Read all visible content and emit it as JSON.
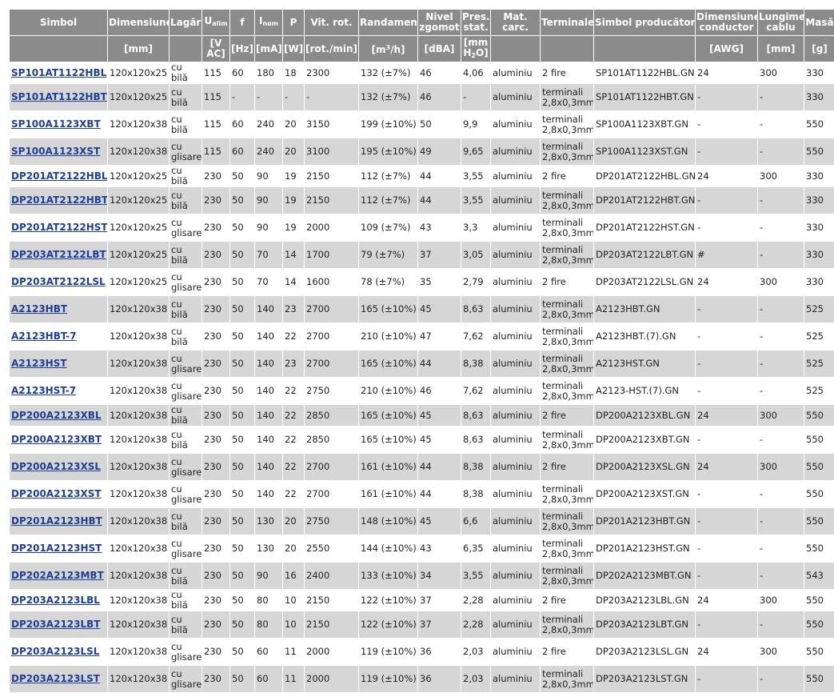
{
  "headers": [
    {
      "key": "simbol",
      "l1": "Simbol",
      "unit": ""
    },
    {
      "key": "dim",
      "l1": "Dimensiune",
      "unit": "[mm]"
    },
    {
      "key": "lagar",
      "l1": "Lagăr",
      "unit": ""
    },
    {
      "key": "ualim",
      "l1": "U",
      "sub": "alim",
      "unit": "[V AC]"
    },
    {
      "key": "f",
      "l1": "f",
      "unit": "[Hz]"
    },
    {
      "key": "inom",
      "l1": "I",
      "sub": "nom",
      "unit": "[mA]"
    },
    {
      "key": "p",
      "l1": "P",
      "unit": "[W]"
    },
    {
      "key": "vit",
      "l1": "Vit. rot.",
      "unit": "[rot./min]"
    },
    {
      "key": "rand",
      "l1": "Randament",
      "unit": "[m",
      "sup": "3",
      "unit_tail": "/h]"
    },
    {
      "key": "zgomot",
      "l1": "Nivel zgomot",
      "unit": "[dBA]"
    },
    {
      "key": "pres",
      "l1": "Pres. stat.",
      "unit": "[mm H",
      "unit_sub": "2",
      "unit_tail": "O]"
    },
    {
      "key": "mat",
      "l1": "Mat. carc.",
      "unit": ""
    },
    {
      "key": "term",
      "l1": "Terminale",
      "unit": ""
    },
    {
      "key": "simprod",
      "l1": "Simbol producător",
      "unit": ""
    },
    {
      "key": "dimcond",
      "l1": "Dimensiune conductor",
      "unit": "[AWG]"
    },
    {
      "key": "lung",
      "l1": "Lungime cablu",
      "unit": "[mm]"
    },
    {
      "key": "masa",
      "l1": "Masă",
      "unit": "[g]"
    }
  ],
  "rows": [
    [
      "SP101AT1122HBL",
      "120x120x25",
      "cu bilă",
      "115",
      "60",
      "180",
      "18",
      "2300",
      "132 (±7%)",
      "46",
      "4,06",
      "aluminiu",
      "2 fire",
      "SP101AT1122HBL.GN",
      "24",
      "300",
      "330"
    ],
    [
      "SP101AT1122HBT",
      "120x120x25",
      "cu bilă",
      "115",
      "-",
      "-",
      "-",
      "-",
      "132 (±7%)",
      "46",
      "-",
      "aluminiu",
      "terminali 2,8x0,3mm",
      "SP101AT1122HBT.GN",
      "-",
      "-",
      "330"
    ],
    [
      "SP100A1123XBT",
      "120x120x38",
      "cu bilă",
      "115",
      "60",
      "240",
      "20",
      "3150",
      "199 (±10%)",
      "50",
      "9,9",
      "aluminiu",
      "terminali 2,8x0,3mm",
      "SP100A1123XBT.GN",
      "-",
      "-",
      "550"
    ],
    [
      "SP100A1123XST",
      "120x120x38",
      "cu glisare",
      "115",
      "60",
      "240",
      "20",
      "3100",
      "195 (±10%)",
      "49",
      "9,65",
      "aluminiu",
      "terminali 2,8x0,3mm",
      "SP100A1123XST.GN",
      "-",
      "-",
      "550"
    ],
    [
      "DP201AT2122HBL",
      "120x120x25",
      "cu bilă",
      "230",
      "50",
      "90",
      "19",
      "2150",
      "112 (±7%)",
      "44",
      "3,55",
      "aluminiu",
      "2 fire",
      "DP201AT2122HBL.GN",
      "24",
      "300",
      "330"
    ],
    [
      "DP201AT2122HBT",
      "120x120x25",
      "cu bilă",
      "230",
      "50",
      "90",
      "19",
      "2150",
      "112 (±7%)",
      "44",
      "3,55",
      "aluminiu",
      "terminali 2,8x0,3mm",
      "DP201AT2122HBT.GN",
      "-",
      "-",
      "330"
    ],
    [
      "DP201AT2122HST",
      "120x120x25",
      "cu glisare",
      "230",
      "50",
      "90",
      "19",
      "2000",
      "109 (±7%)",
      "43",
      "3,3",
      "aluminiu",
      "terminali 2,8x0,3mm",
      "DP201AT2122HST.GN",
      "-",
      "-",
      "330"
    ],
    [
      "DP203AT2122LBT",
      "120x120x25",
      "cu bilă",
      "230",
      "50",
      "70",
      "14",
      "1700",
      "79 (±7%)",
      "37",
      "3,05",
      "aluminiu",
      "terminali 2,8x0,3mm",
      "DP203AT2122LBT.GN",
      "#",
      "-",
      "330"
    ],
    [
      "DP203AT2122LSL",
      "120x120x25",
      "cu glisare",
      "230",
      "50",
      "70",
      "14",
      "1600",
      "78 (±7%)",
      "35",
      "2,79",
      "aluminiu",
      "2 fire",
      "DP203AT2122LSL.GN",
      "24",
      "300",
      "330"
    ],
    [
      "A2123HBT",
      "120x120x38",
      "cu bilă",
      "230",
      "50",
      "140",
      "23",
      "2700",
      "165 (±10%)",
      "45",
      "8,63",
      "aluminiu",
      "terminali 2,8x0,3mm",
      "A2123HBT.GN",
      "-",
      "-",
      "525"
    ],
    [
      "A2123HBT-7",
      "120x120x38",
      "cu bilă",
      "230",
      "50",
      "140",
      "22",
      "2700",
      "210 (±10%)",
      "47",
      "7,62",
      "aluminiu",
      "terminali 2,8x0,3mm",
      "A2123HBT.(7).GN",
      "-",
      "-",
      "525"
    ],
    [
      "A2123HST",
      "120x120x38",
      "cu glisare",
      "230",
      "50",
      "140",
      "23",
      "2700",
      "165 (±10%)",
      "44",
      "8,38",
      "aluminiu",
      "terminali 2,8x0,3mm",
      "A2123HST.GN",
      "-",
      "-",
      "525"
    ],
    [
      "A2123HST-7",
      "120x120x38",
      "cu glisare",
      "230",
      "50",
      "140",
      "22",
      "2750",
      "210 (±10%)",
      "46",
      "7,62",
      "aluminiu",
      "terminali 2,8x0,3mm",
      "A2123-HST.(7).GN",
      "-",
      "-",
      "525"
    ],
    [
      "DP200A2123XBL",
      "120x120x38",
      "cu bilă",
      "230",
      "50",
      "140",
      "22",
      "2850",
      "165 (±10%)",
      "45",
      "8,63",
      "aluminiu",
      "2 fire",
      "DP200A2123XBL.GN",
      "24",
      "300",
      "550"
    ],
    [
      "DP200A2123XBT",
      "120x120x38",
      "cu bilă",
      "230",
      "50",
      "140",
      "22",
      "2850",
      "165 (±10%)",
      "45",
      "8,63",
      "aluminiu",
      "terminali 2,8x0,3mm",
      "DP200A2123XBT.GN",
      "-",
      "-",
      "550"
    ],
    [
      "DP200A2123XSL",
      "120x120x38",
      "cu glisare",
      "230",
      "50",
      "140",
      "22",
      "2700",
      "161 (±10%)",
      "44",
      "8,38",
      "aluminiu",
      "2 fire",
      "DP200A2123XSL.GN",
      "24",
      "300",
      "550"
    ],
    [
      "DP200A2123XST",
      "120x120x38",
      "cu glisare",
      "230",
      "50",
      "140",
      "22",
      "2700",
      "161 (±10%)",
      "44",
      "8,38",
      "aluminiu",
      "terminali 2,8x0,3mm",
      "DP200A2123XST.GN",
      "-",
      "-",
      "550"
    ],
    [
      "DP201A2123HBT",
      "120x120x38",
      "cu bilă",
      "230",
      "50",
      "130",
      "20",
      "2750",
      "148 (±10%)",
      "45",
      "6,6",
      "aluminiu",
      "terminali 2,8x0,3mm",
      "DP201A2123HBT.GN",
      "-",
      "-",
      "550"
    ],
    [
      "DP201A2123HST",
      "120x120x38",
      "cu glisare",
      "230",
      "50",
      "130",
      "20",
      "2550",
      "144 (±10%)",
      "43",
      "6,35",
      "aluminiu",
      "terminali 2,8x0,3mm",
      "DP201A2123HST.GN",
      "-",
      "-",
      "550"
    ],
    [
      "DP202A2123MBT",
      "120x120x38",
      "cu bilă",
      "230",
      "50",
      "90",
      "16",
      "2400",
      "133 (±10%)",
      "34",
      "3,55",
      "aluminiu",
      "terminali 2,8x0,3mm",
      "DP202A2123MBT.GN",
      "-",
      "-",
      "543"
    ],
    [
      "DP203A2123LBL",
      "120x120x38",
      "cu bilă",
      "230",
      "50",
      "80",
      "10",
      "2150",
      "122 (±10%)",
      "37",
      "2,28",
      "aluminiu",
      "2 fire",
      "DP203A2123LBL.GN",
      "24",
      "300",
      "550"
    ],
    [
      "DP203A2123LBT",
      "120x120x38",
      "cu bilă",
      "230",
      "50",
      "80",
      "10",
      "2150",
      "122 (±10%)",
      "37",
      "2,28",
      "aluminiu",
      "terminali 2,8x0,3mm",
      "DP203A2123LBT.GN",
      "-",
      "-",
      "550"
    ],
    [
      "DP203A2123LSL",
      "120x120x38",
      "cu glisare",
      "230",
      "50",
      "60",
      "11",
      "2000",
      "119 (±10%)",
      "36",
      "2,03",
      "aluminiu",
      "2 fire",
      "DP203A2123LSL.GN",
      "24",
      "300",
      "550"
    ],
    [
      "DP203A2123LST",
      "120x120x38",
      "cu glisare",
      "230",
      "50",
      "60",
      "11",
      "2000",
      "119 (±10%)",
      "36",
      "2,03",
      "aluminiu",
      "terminali 2,8x0,3mm",
      "DP203A2123LST.GN",
      "-",
      "-",
      "550"
    ]
  ],
  "colors": {
    "header_bg": "#8b8b8b",
    "alt_row_bg": "#d6d6d6",
    "link": "#1f3f94"
  }
}
